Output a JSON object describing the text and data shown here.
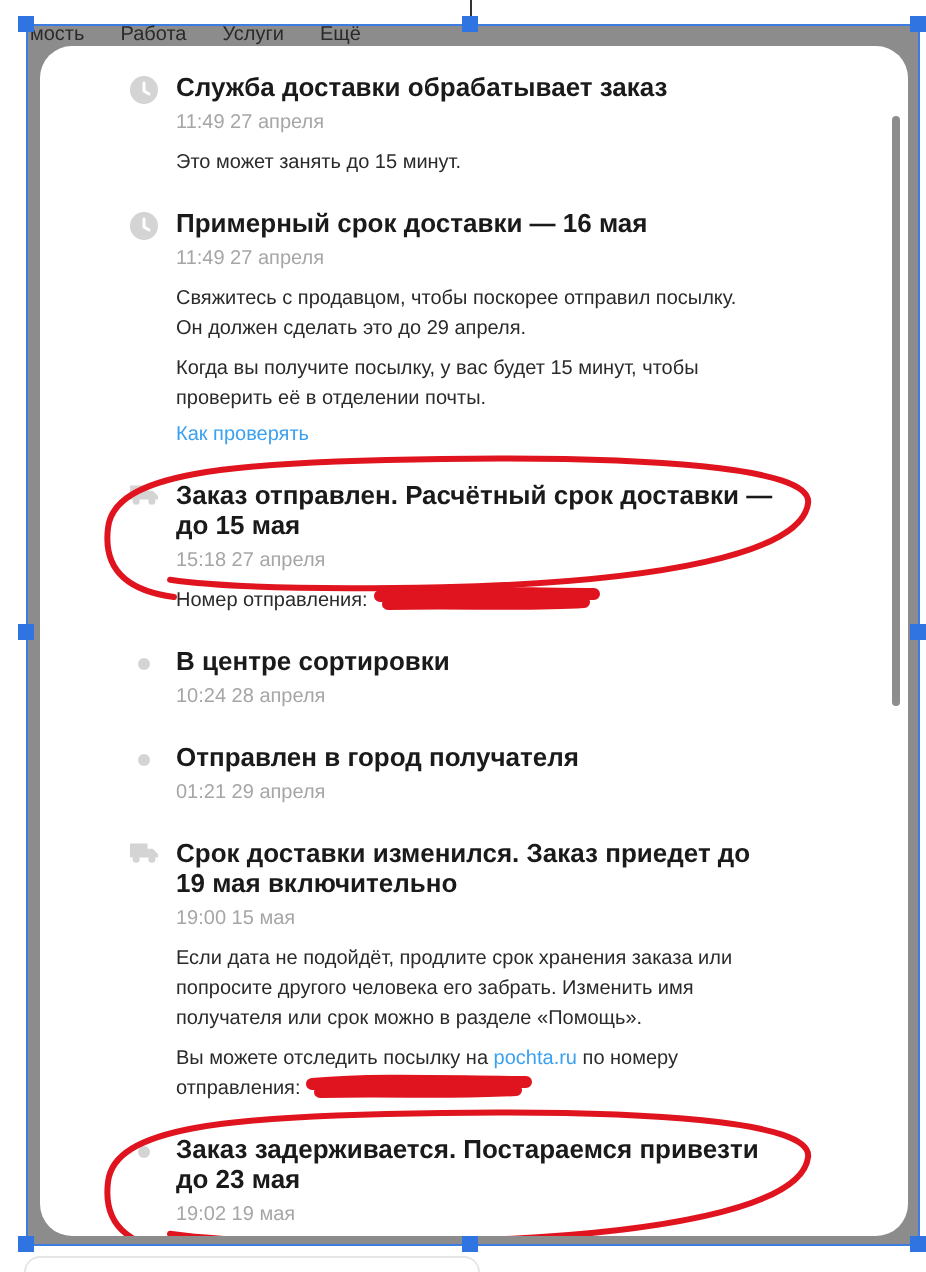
{
  "nav": [
    "мость",
    "Работа",
    "Услуги",
    "Ещё"
  ],
  "events": [
    {
      "kind": "clock",
      "circled": false,
      "title": "Служба доставки обрабатывает заказ",
      "time": "11:49 27 апреля",
      "paragraphs": [
        {
          "redacted": false,
          "parts": [
            {
              "text": "Это может занять до 15 минут."
            }
          ]
        }
      ]
    },
    {
      "kind": "clock",
      "circled": false,
      "title": "Примерный срок доставки — 16 мая",
      "time": "11:49 27 апреля",
      "paragraphs": [
        {
          "redacted": false,
          "parts": [
            {
              "text": "Свяжитесь с продавцом, чтобы поскорее отправил посылку. Он должен сделать это до 29 апреля."
            }
          ]
        },
        {
          "redacted": false,
          "parts": [
            {
              "text": "Когда вы получите посылку, у вас будет 15 минут, чтобы проверить её в отделении почты."
            }
          ]
        }
      ],
      "link": "Как проверять"
    },
    {
      "kind": "truck",
      "circled": true,
      "title": "Заказ отправлен. Расчётный срок доставки — до 15 мая",
      "time": "15:18 27 апреля",
      "paragraphs": [
        {
          "redacted": true,
          "parts": [
            {
              "text": "Номер отправления:"
            }
          ]
        }
      ]
    },
    {
      "kind": "dot",
      "circled": false,
      "title": "В центре сортировки",
      "time": "10:24 28 апреля"
    },
    {
      "kind": "dot",
      "circled": false,
      "title": "Отправлен в город получателя",
      "time": "01:21 29 апреля"
    },
    {
      "kind": "truck",
      "circled": false,
      "title": "Срок доставки изменился. Заказ приедет до 19 мая включительно",
      "time": "19:00 15 мая",
      "paragraphs": [
        {
          "redacted": false,
          "parts": [
            {
              "text": "Если дата не подойдёт, продлите срок хранения заказа или попросите другого человека его забрать. Изменить имя получателя или срок можно в разделе «Помощь»."
            }
          ]
        },
        {
          "redacted": true,
          "parts": [
            {
              "text": "Вы можете отследить посылку на "
            },
            {
              "text": "pochta.ru",
              "link": true
            },
            {
              "text": " по номеру отправления:"
            }
          ]
        }
      ]
    },
    {
      "kind": "dot",
      "circled": true,
      "title": "Заказ задерживается. Постараемся привезти до 23 мая",
      "time": "19:02 19 мая"
    }
  ]
}
